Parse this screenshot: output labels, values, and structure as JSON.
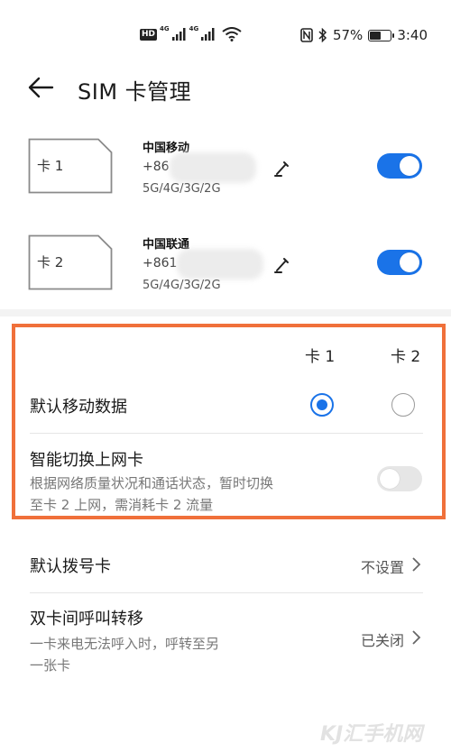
{
  "status_bar": {
    "hd_badge": "HD",
    "signal1_tag": "4G",
    "signal2_tag": "4G",
    "battery_percent": "57%",
    "battery_level": 0.57,
    "time": "3:40"
  },
  "header": {
    "title": "SIM 卡管理"
  },
  "sims": [
    {
      "card_label": "卡 1",
      "carrier": "中国移动",
      "phone_prefix": "+86",
      "network": "5G/4G/3G/2G",
      "enabled": true
    },
    {
      "card_label": "卡 2",
      "carrier": "中国联通",
      "phone_prefix": "+861",
      "network": "5G/4G/3G/2G",
      "enabled": true
    }
  ],
  "data_section": {
    "col1": "卡 1",
    "col2": "卡 2",
    "default_data_label": "默认移动数据",
    "default_data_selected": "卡 1",
    "smart_switch_label": "智能切换上网卡",
    "smart_switch_desc_line1": "根据网络质量状况和通话状态，暂时切换",
    "smart_switch_desc_line2": "至卡 2 上网，需消耗卡 2 流量",
    "smart_switch_enabled": false
  },
  "settings": {
    "default_dial_label": "默认拨号卡",
    "default_dial_value": "不设置",
    "call_forward_label": "双卡间呼叫转移",
    "call_forward_desc_line1": "一卡来电无法呼入时，呼转至另",
    "call_forward_desc_line2": "一张卡",
    "call_forward_value": "已关闭"
  },
  "watermark": "KJ汇手机网",
  "colors": {
    "accent": "#1a73e8",
    "highlight_border": "#f0703a"
  }
}
